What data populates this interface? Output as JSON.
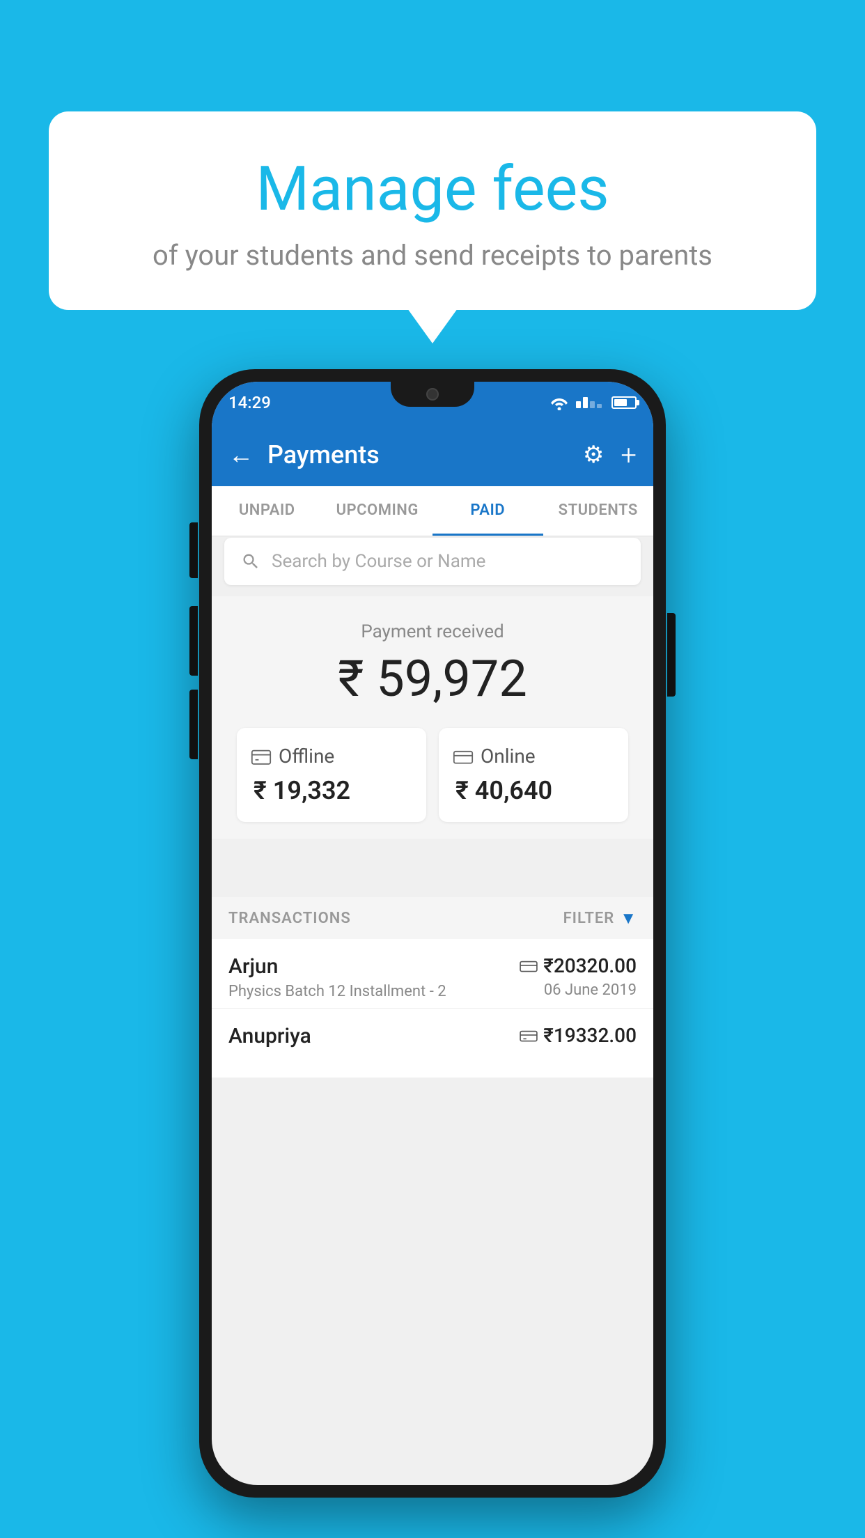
{
  "page": {
    "bg_color": "#1ab8e8"
  },
  "bubble": {
    "title": "Manage fees",
    "subtitle": "of your students and send receipts to parents"
  },
  "status_bar": {
    "time": "14:29"
  },
  "header": {
    "title": "Payments",
    "back_label": "←",
    "gear_icon": "⚙",
    "plus_icon": "+"
  },
  "tabs": [
    {
      "label": "UNPAID",
      "active": false
    },
    {
      "label": "UPCOMING",
      "active": false
    },
    {
      "label": "PAID",
      "active": true
    },
    {
      "label": "STUDENTS",
      "active": false
    }
  ],
  "search": {
    "placeholder": "Search by Course or Name"
  },
  "payment_summary": {
    "received_label": "Payment received",
    "total_amount": "₹ 59,972",
    "offline_label": "Offline",
    "offline_amount": "₹ 19,332",
    "online_label": "Online",
    "online_amount": "₹ 40,640"
  },
  "transactions_section": {
    "label": "TRANSACTIONS",
    "filter_label": "FILTER",
    "filter_icon": "▼"
  },
  "transactions": [
    {
      "name": "Arjun",
      "description": "Physics Batch 12 Installment - 2",
      "amount": "₹20320.00",
      "date": "06 June 2019",
      "payment_type": "card"
    },
    {
      "name": "Anupriya",
      "description": "",
      "amount": "₹19332.00",
      "date": "",
      "payment_type": "cash"
    }
  ]
}
